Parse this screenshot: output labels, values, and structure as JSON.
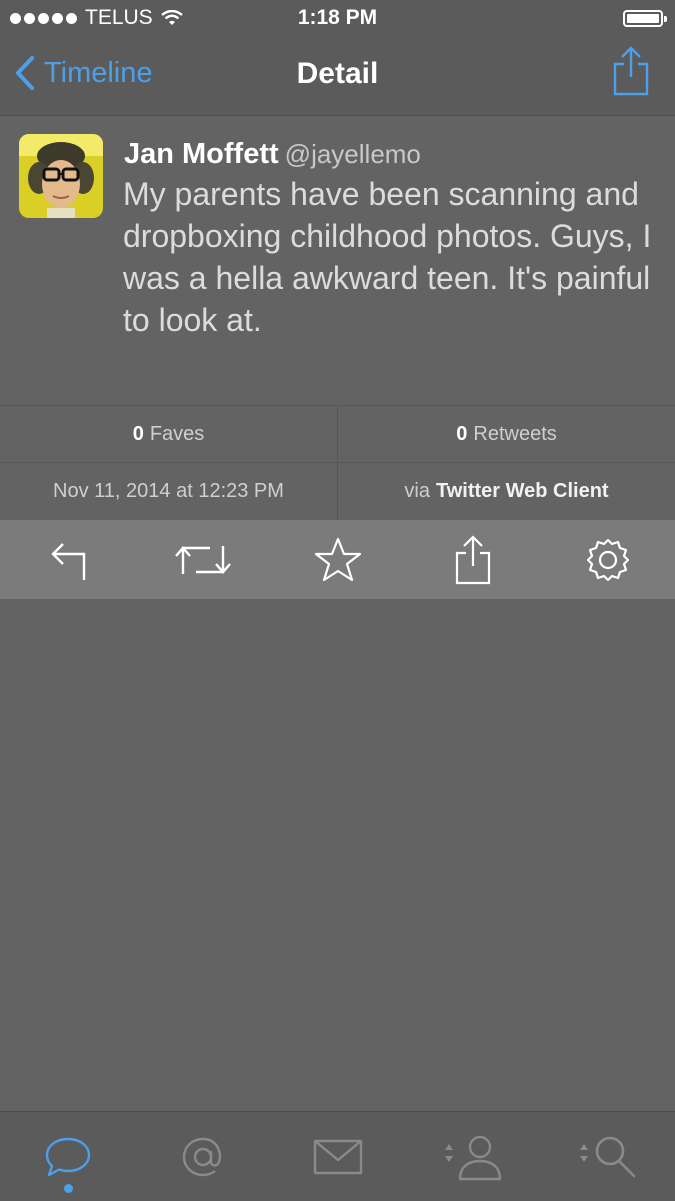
{
  "status_bar": {
    "carrier": "TELUS",
    "time": "1:18 PM"
  },
  "nav": {
    "back_label": "Timeline",
    "title": "Detail"
  },
  "tweet": {
    "author_name": "Jan Moffett",
    "author_handle": "@jayellemo",
    "text": "My parents have been scanning and dropboxing childhood photos. Guys, I was a hella awkward teen. It's painful to look at."
  },
  "stats": {
    "faves_count": "0",
    "faves_label": "Faves",
    "retweets_count": "0",
    "retweets_label": "Retweets"
  },
  "meta": {
    "timestamp": "Nov 11, 2014 at 12:23 PM",
    "via_prefix": "via",
    "client": "Twitter Web Client"
  },
  "actions": [
    {
      "icon": "reply-icon"
    },
    {
      "icon": "retweet-icon"
    },
    {
      "icon": "star-icon"
    },
    {
      "icon": "share-icon"
    },
    {
      "icon": "gear-icon"
    }
  ],
  "tabs": [
    {
      "icon": "timeline-bubble-icon",
      "active": true
    },
    {
      "icon": "at-icon"
    },
    {
      "icon": "mail-icon"
    },
    {
      "icon": "profile-icon"
    },
    {
      "icon": "search-icon"
    }
  ],
  "colors": {
    "accent": "#4d9fea",
    "background": "#636363",
    "action_bar": "#7b7b7b"
  }
}
